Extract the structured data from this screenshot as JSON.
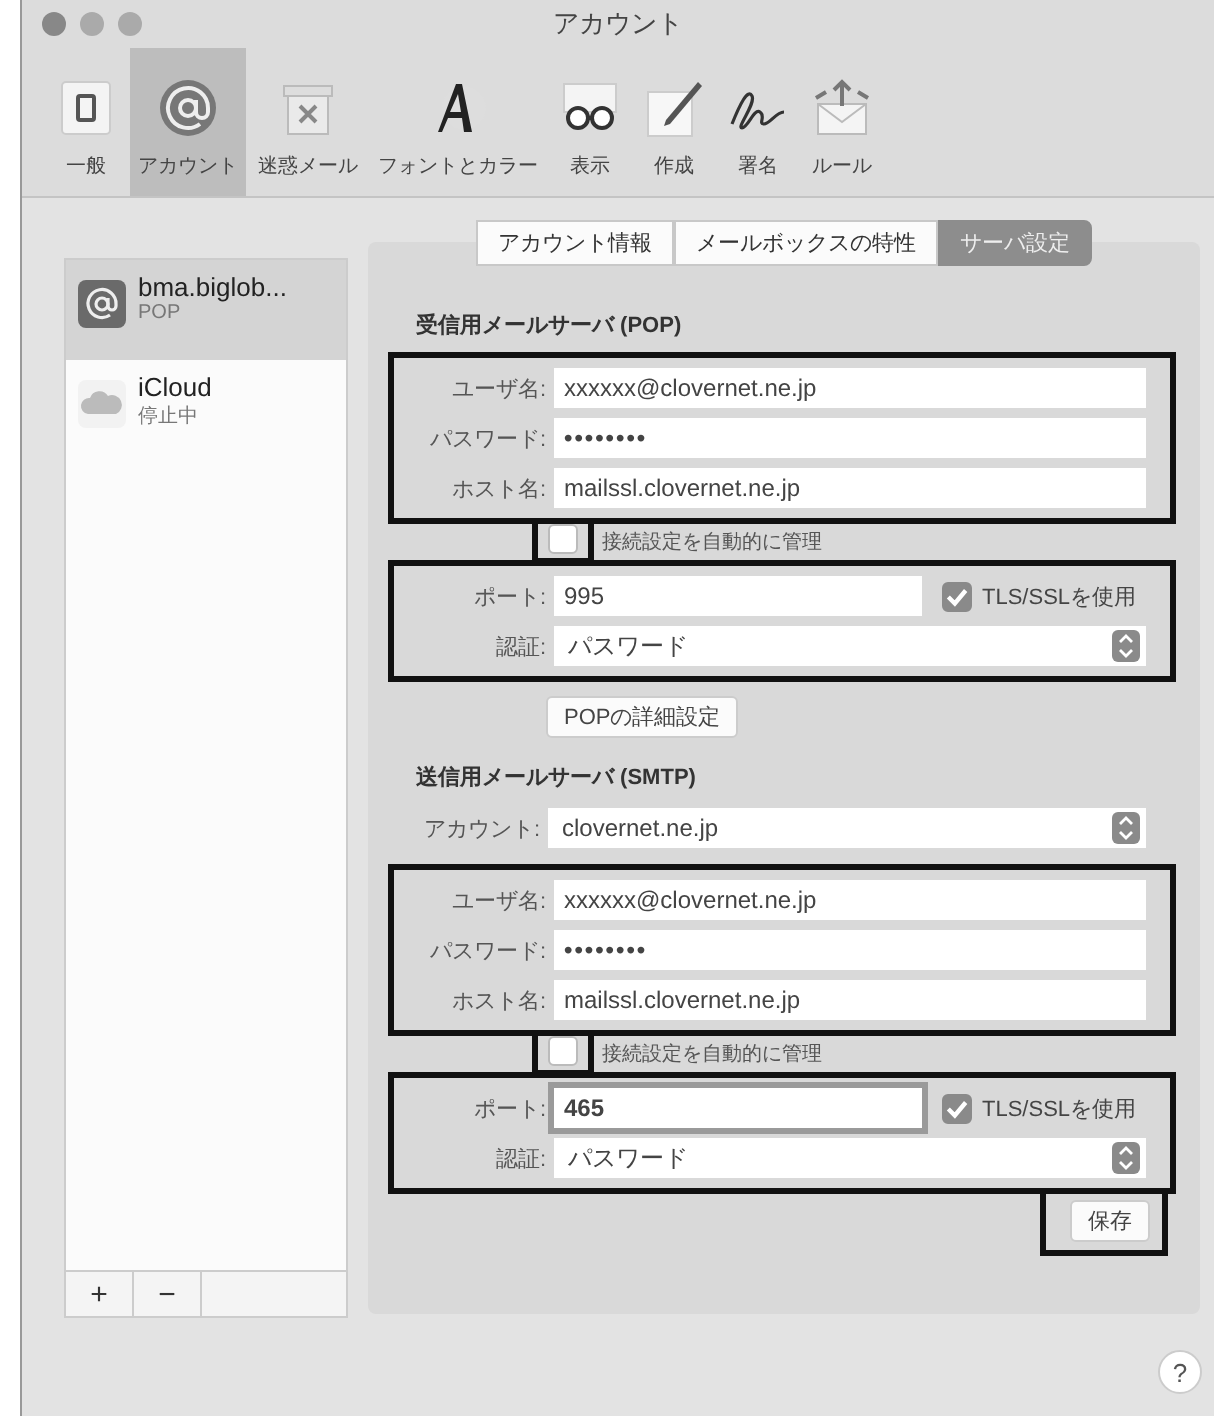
{
  "window": {
    "title": "アカウント"
  },
  "toolbar": [
    {
      "label": "一般",
      "kind": "general",
      "selected": false
    },
    {
      "label": "アカウント",
      "kind": "at",
      "selected": true
    },
    {
      "label": "迷惑メール",
      "kind": "junk",
      "selected": false
    },
    {
      "label": "フォントとカラー",
      "kind": "font",
      "selected": false
    },
    {
      "label": "表示",
      "kind": "glasses",
      "selected": false
    },
    {
      "label": "作成",
      "kind": "compose",
      "selected": false
    },
    {
      "label": "署名",
      "kind": "signature",
      "selected": false
    },
    {
      "label": "ルール",
      "kind": "rules",
      "selected": false
    }
  ],
  "sidebar": {
    "accounts": [
      {
        "name": "bma.biglob...",
        "status": "POP",
        "kind": "at",
        "selected": true
      },
      {
        "name": "iCloud",
        "status": "停止中",
        "kind": "cloud",
        "selected": false
      }
    ],
    "buttons": [
      "+",
      "−"
    ]
  },
  "tabs": [
    {
      "label": "アカウント情報",
      "selected": false
    },
    {
      "label": "メールボックスの特性",
      "selected": false
    },
    {
      "label": "サーバ設定",
      "selected": true
    }
  ],
  "incoming": {
    "heading": "受信用メールサーバ (POP)",
    "fields": [
      {
        "label": "ユーザ名:",
        "value": "xxxxxx@clovernet.ne.jp"
      },
      {
        "label": "パスワード:",
        "value": "••••••••"
      },
      {
        "label": "ホスト名:",
        "value": "mailssl.clovernet.ne.jp"
      }
    ],
    "auto_manage": {
      "label": "接続設定を自動的に管理",
      "checked": false
    },
    "port": {
      "label": "ポート:",
      "value": "995",
      "focused": false
    },
    "tls": {
      "label": "TLS/SSLを使用",
      "checked": true
    },
    "auth": {
      "label": "認証:",
      "value": "パスワード"
    },
    "advanced_button": "POPの詳細設定"
  },
  "outgoing": {
    "heading": "送信用メールサーバ (SMTP)",
    "account": {
      "label": "アカウント:",
      "value": "clovernet.ne.jp"
    },
    "fields": [
      {
        "label": "ユーザ名:",
        "value": "xxxxxx@clovernet.ne.jp"
      },
      {
        "label": "パスワード:",
        "value": "••••••••"
      },
      {
        "label": "ホスト名:",
        "value": "mailssl.clovernet.ne.jp"
      }
    ],
    "auto_manage": {
      "label": "接続設定を自動的に管理",
      "checked": false
    },
    "port": {
      "label": "ポート:",
      "value": "465",
      "focused": true
    },
    "tls": {
      "label": "TLS/SSLを使用",
      "checked": true
    },
    "auth": {
      "label": "認証:",
      "value": "パスワード"
    }
  },
  "save_button": "保存",
  "help_button": "?"
}
